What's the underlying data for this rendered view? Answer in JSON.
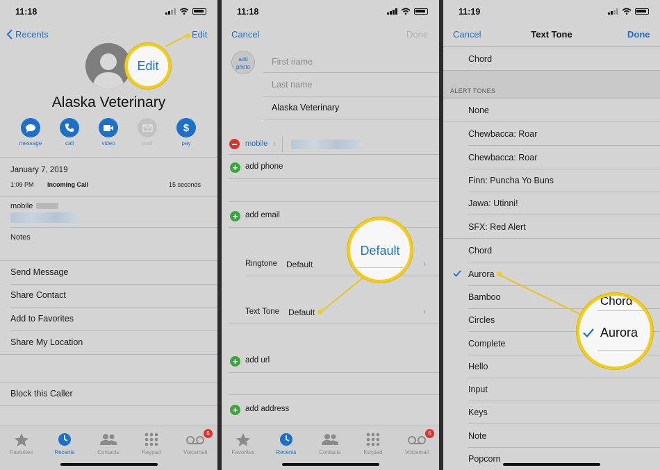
{
  "panel1": {
    "time": "11:18",
    "back_label": "Recents",
    "edit_label": "Edit",
    "edit_callout": "Edit",
    "contact_name": "Alaska Veterinary",
    "actions": [
      {
        "label": "message",
        "icon": "message-icon"
      },
      {
        "label": "call",
        "icon": "phone-icon"
      },
      {
        "label": "video",
        "icon": "video-icon"
      },
      {
        "label": "mail",
        "icon": "mail-icon"
      },
      {
        "label": "pay",
        "icon": "dollar-icon"
      }
    ],
    "call_date": "January 7, 2019",
    "call_time": "1:09 PM",
    "call_type": "Incoming Call",
    "call_duration": "15 seconds",
    "phone_label": "mobile",
    "notes_label": "Notes",
    "links": [
      "Send Message",
      "Share Contact",
      "Add to Favorites",
      "Share My Location"
    ],
    "block_label": "Block this Caller"
  },
  "panel2": {
    "time": "11:18",
    "cancel_label": "Cancel",
    "done_label": "Done",
    "add_photo_label": "add\nphoto",
    "first_name_placeholder": "First name",
    "last_name_placeholder": "Last name",
    "company_value": "Alaska Veterinary",
    "phone_label": "mobile",
    "add_phone_label": "add phone",
    "add_email_label": "add email",
    "ringtone_label": "Ringtone",
    "ringtone_value": "Default",
    "text_tone_label": "Text Tone",
    "text_tone_value": "Default",
    "default_callout": "Default",
    "add_url_label": "add url",
    "add_address_label": "add address"
  },
  "panel3": {
    "time": "11:19",
    "cancel_label": "Cancel",
    "title": "Text Tone",
    "done_label": "Done",
    "top_item": "Chord",
    "section_header": "ALERT TONES",
    "alert_tones": [
      "None",
      "Chewbacca: Roar",
      "Chewbacca: Roar",
      "Finn: Puncha Yo Buns",
      "Jawa: Utinni!",
      "SFX: Red Alert"
    ],
    "tones": [
      "Chord",
      "Aurora",
      "Bamboo",
      "Circles",
      "Complete",
      "Hello",
      "Input",
      "Keys",
      "Note",
      "Popcorn"
    ],
    "selected_tone": "Aurora",
    "callout_selected": "Aurora",
    "callout_above": "Chord"
  },
  "tabbar": {
    "tabs": [
      {
        "label": "Favorites",
        "icon": "star-icon"
      },
      {
        "label": "Recents",
        "icon": "clock-icon"
      },
      {
        "label": "Contacts",
        "icon": "contacts-icon"
      },
      {
        "label": "Keypad",
        "icon": "keypad-icon"
      },
      {
        "label": "Voicemail",
        "icon": "voicemail-icon"
      }
    ],
    "voicemail_badge": "6"
  },
  "colors": {
    "accent": "#1d6fc7",
    "highlight": "#f2cd1e",
    "add_green": "#3aa53e",
    "delete_red": "#d9342b"
  }
}
